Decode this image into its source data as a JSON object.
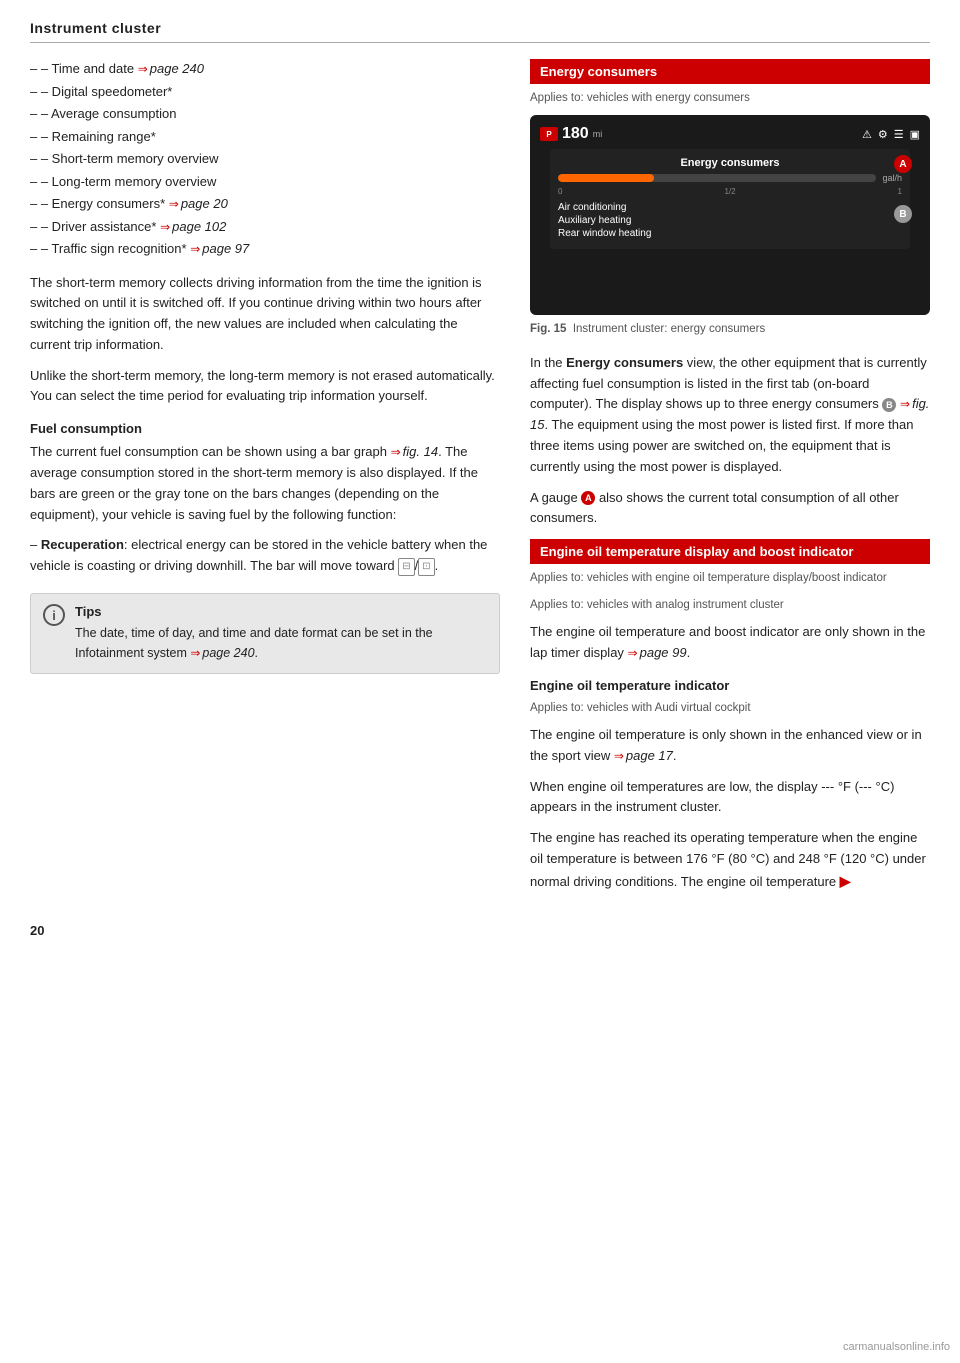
{
  "page": {
    "header_title": "Instrument cluster",
    "page_number": "20",
    "watermark": "carmanualsonline.info"
  },
  "left_col": {
    "bullet_items": [
      {
        "text": "Time and date ",
        "link": "page 240",
        "suffix": ""
      },
      {
        "text": "Digital speedometer*",
        "link": "",
        "suffix": ""
      },
      {
        "text": "Average consumption",
        "link": "",
        "suffix": ""
      },
      {
        "text": "Remaining range*",
        "link": "",
        "suffix": ""
      },
      {
        "text": "Short-term memory overview",
        "link": "",
        "suffix": ""
      },
      {
        "text": "Long-term memory overview",
        "link": "",
        "suffix": ""
      },
      {
        "text": "Energy consumers* ",
        "link": "page 20",
        "suffix": ""
      },
      {
        "text": "Driver assistance* ",
        "link": "page 102",
        "suffix": ""
      },
      {
        "text": "Traffic sign recognition* ",
        "link": "page 97",
        "suffix": ""
      }
    ],
    "body_paragraphs": [
      "The short-term memory collects driving information from the time the ignition is switched on until it is switched off. If you continue driving within two hours after switching the ignition off, the new values are included when calculating the current trip information.",
      "Unlike the short-term memory, the long-term memory is not erased automatically. You can select the time period for evaluating trip information yourself."
    ],
    "fuel_section": {
      "heading": "Fuel consumption",
      "paragraph": "The current fuel consumption can be shown using a bar graph ⇒ fig. 14. The average consumption stored in the short-term memory is also displayed. If the bars are green or the gray tone on the bars changes (depending on the equipment), your vehicle is saving fuel by the following function:"
    },
    "recuperation": {
      "label": "Recuperation",
      "text": ": electrical energy can be stored in the vehicle battery when the vehicle is coasting or driving downhill. The bar will move toward"
    },
    "tips": {
      "icon": "i",
      "title": "Tips",
      "text": "The date, time of day, and time and date format can be set in the Infotainment system ⇒ page 240."
    }
  },
  "right_col": {
    "energy_section": {
      "header": "Energy consumers",
      "applies_to": "Applies to: vehicles with energy consumers",
      "cluster": {
        "speed": "180 mi",
        "gal_unit": "gal/h",
        "scale_labels": [
          "0",
          "1/2",
          "1"
        ],
        "list_items": [
          "Air conditioning",
          "Auxiliary heating",
          "Rear window heating"
        ],
        "label_a": "A",
        "label_b": "B"
      },
      "fig_caption": "Fig. 15",
      "fig_caption_text": "Instrument cluster: energy consumers",
      "body_text_1": "In the ",
      "body_bold": "Energy consumers",
      "body_text_2": " view, the other equipment that is currently affecting fuel consumption is listed in the first tab (on-board computer). The display shows up to three energy consumers",
      "circle_b": "B",
      "body_text_3": "⇒ fig. 15. The equipment using the most power is listed first. If more than three items using power are switched on, the equipment that is currently using the most power is displayed.",
      "body_text_4": "A gauge",
      "circle_a": "A",
      "body_text_5": " also shows the current total consumption of all other consumers."
    },
    "engine_oil_section": {
      "header": "Engine oil temperature display and boost indicator",
      "applies_to_1": "Applies to: vehicles with engine oil temperature display/boost indicator",
      "applies_to_2": "Applies to: vehicles with analog instrument cluster",
      "body_text": "The engine oil temperature and boost indicator are only shown in the lap timer display ⇒ page 99.",
      "sub_heading": "Engine oil temperature indicator",
      "sub_applies_to": "Applies to: vehicles with Audi virtual cockpit",
      "sub_body_1": "The engine oil temperature is only shown in the enhanced view or in the sport view ⇒ page 17.",
      "sub_body_2": "When engine oil temperatures are low, the display --- °F (--- °C) appears in the instrument cluster.",
      "sub_body_3": "The engine has reached its operating temperature when the engine oil temperature is between 176 °F (80 °C) and 248 °F (120 °C) under normal driving conditions. The engine oil temperature",
      "more_arrow": "►"
    }
  }
}
